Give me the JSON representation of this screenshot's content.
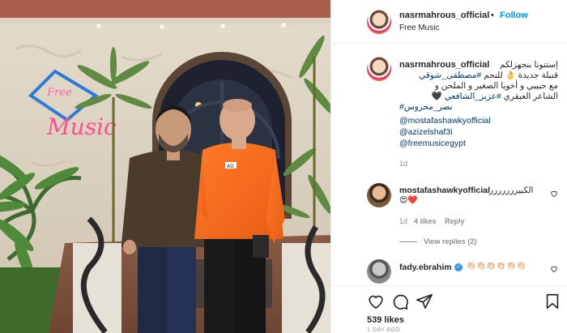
{
  "header": {
    "username": "nasrmahrous_official",
    "separator": "•",
    "follow_label": "Follow",
    "subtitle": "Free Music"
  },
  "caption": {
    "username": "nasrmahrous_official",
    "line1": "إستنونا بنجهزلكم",
    "line2_prefix": "قنبلة جديدة",
    "line2_emoji": "👌",
    "line2_suffix": "للنجم",
    "line2_tag": "#مصطفى_شوقي",
    "line3": "مع حبيبي و أخويا الصغير و الملحن و",
    "line4_prefix": "الشاعر العبقري",
    "line4_tag": "#عزيز_الشافعي",
    "line4_emoji": "🖤",
    "line5_tag": "نصر_محروس#",
    "mentions": [
      "@mostafashawkyofficial",
      "@azizelshaf3i",
      "@freemusicegypt"
    ],
    "time": "1d"
  },
  "comments": [
    {
      "username": "mostafashawkyofficial",
      "text": "الكبيررررررر",
      "emojis": "😍❤️",
      "time": "1d",
      "likes": "4 likes",
      "reply": "Reply",
      "view_replies": "View replies (2)"
    },
    {
      "username": "fady.ebrahim",
      "verified": "✓",
      "emojis": "👏🏻👏🏻👏🏻👏🏻👏🏻👏🏻"
    }
  ],
  "footer": {
    "likes": "539 likes",
    "date": "1 DAY AGO"
  },
  "colors": {
    "link": "#0095f6",
    "mention": "#00376b",
    "muted": "#8e8e8e",
    "text": "#262626"
  },
  "photo": {
    "sign_top": "Music",
    "sign_bottom": "Music",
    "shirt_label": "AD"
  }
}
